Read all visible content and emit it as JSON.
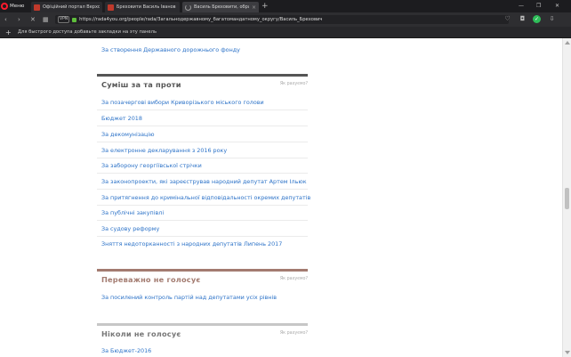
{
  "browser": {
    "menu_label": "Меню",
    "tabs": [
      {
        "title": "Офіційний портал Верхо"
      },
      {
        "title": "Бреховити Василь Іванов"
      },
      {
        "title": "Василь Бреховити, обра"
      }
    ],
    "url": "https://rada4you.org/people/rada/Загальнодержавному_багатомандатному_округу/Василь_Брехович",
    "vpn_label": "VPN",
    "bookmarks_hint": "Для быстрого доступа добавьте закладки на эту панель"
  },
  "top_link": "За створення Державного дорожнього фонду",
  "sections": {
    "mixed": {
      "title": "Суміш за та проти",
      "howto": "Як рахуємо?",
      "items": [
        "За позачергові вибори Криворізького міського голови",
        "Бюджет 2018",
        "За декомунізацію",
        "За електронне декларування з 2016 року",
        "За заборону георгіївської стрічки",
        "За законопроекти, які зареєстрував народний депутат Артем Ільюк",
        "За притягнення до кримінальної відповідальності окремих депутатів",
        "За публічні закупівлі",
        "За судову реформу",
        "Зняття недоторканності з народних депутатів Липень 2017"
      ]
    },
    "mostly_not": {
      "title": "Переважно не голосує",
      "howto": "Як рахуємо?",
      "items": [
        "За посилений контроль партій над депутатами усіх рівнів"
      ]
    },
    "never": {
      "title": "Ніколи не голосує",
      "howto": "Як рахуємо?",
      "items": [
        "За Бюджет-2016"
      ]
    }
  },
  "colors": {
    "link": "#2d73c8",
    "mixed_bar": "#555555",
    "mostly_not_bar": "#a37b70",
    "never_bar": "#c7c7c7"
  }
}
